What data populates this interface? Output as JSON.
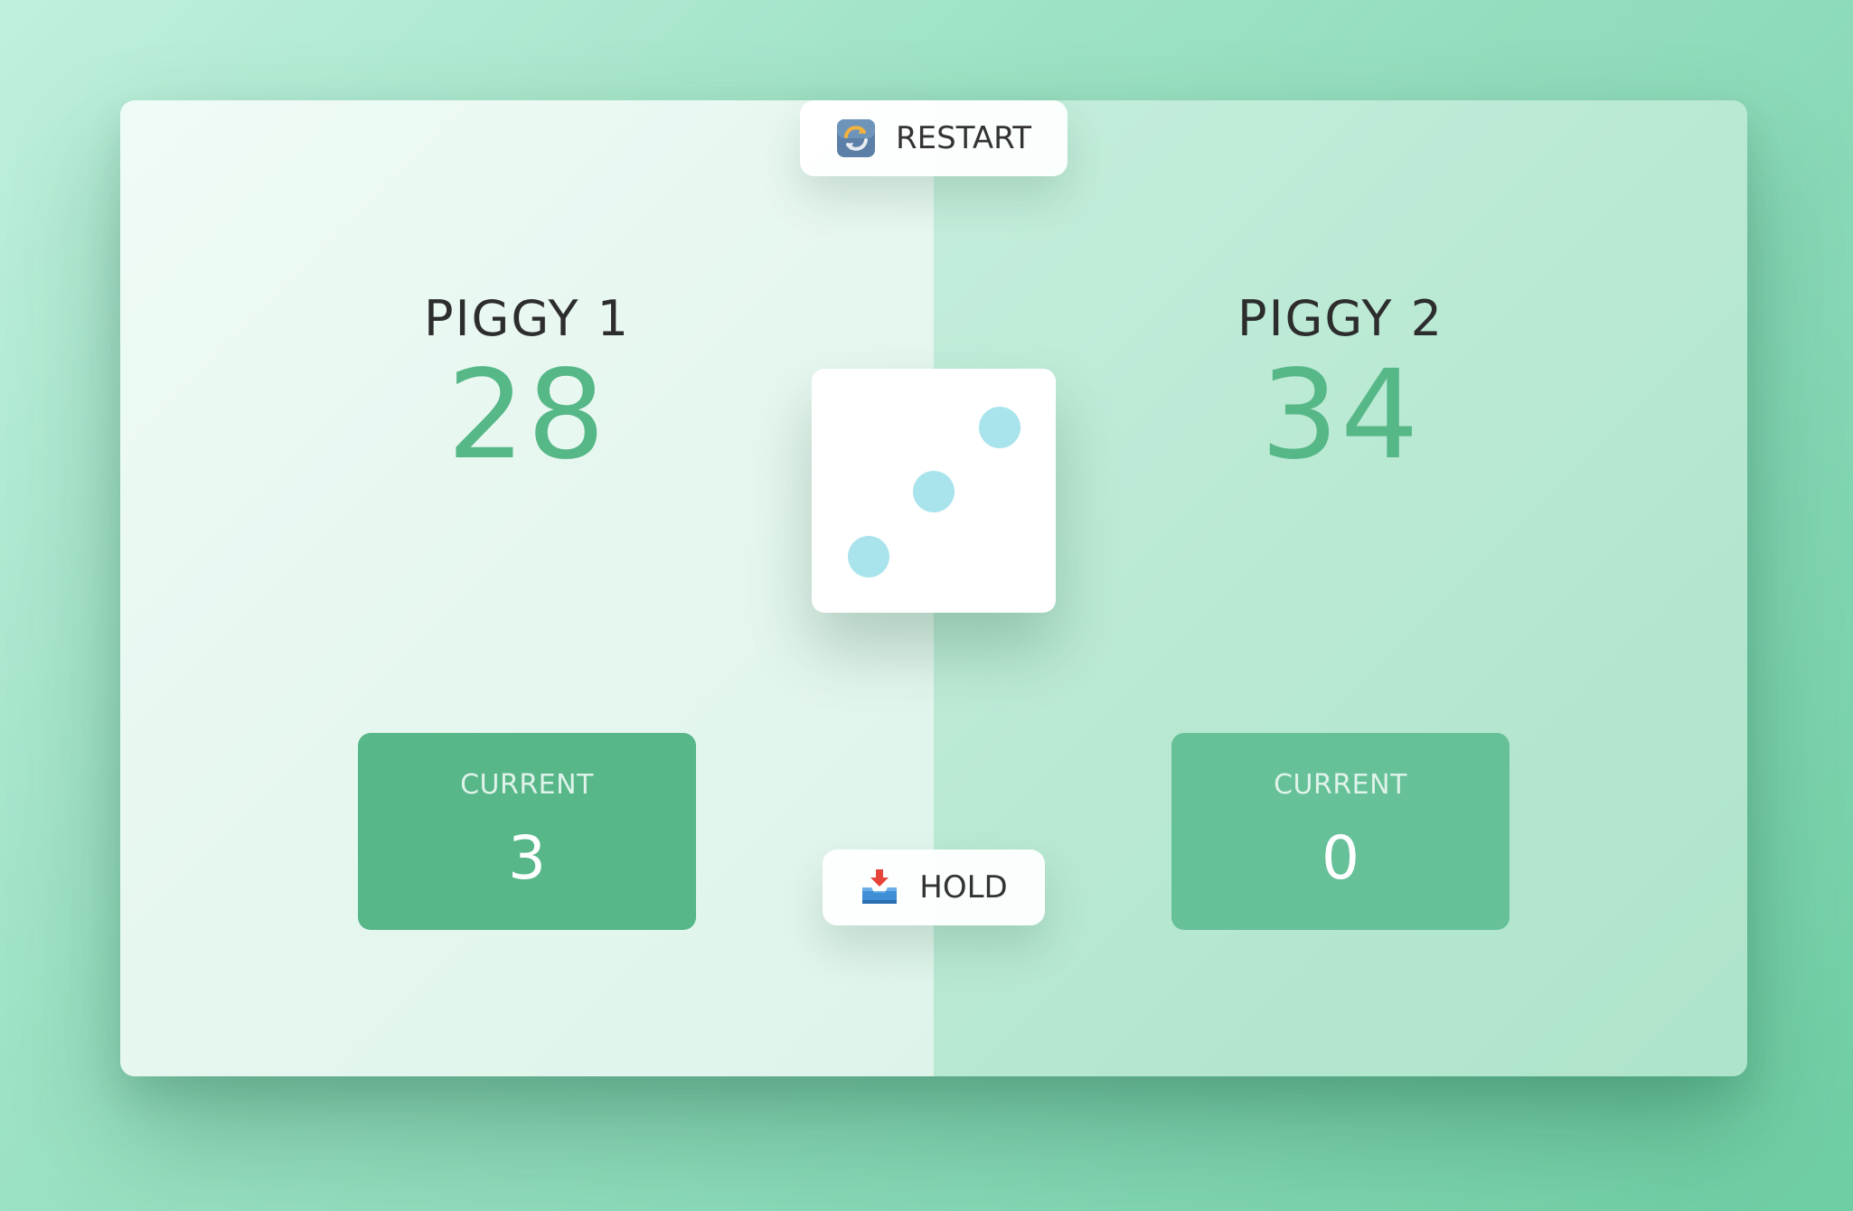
{
  "players": [
    {
      "name": "PIGGY 1",
      "score": "28",
      "current_label": "CURRENT",
      "current_score": "3"
    },
    {
      "name": "PIGGY 2",
      "score": "34",
      "current_label": "CURRENT",
      "current_score": "0"
    }
  ],
  "controls": {
    "restart_label": "RESTART",
    "restart_icon": "restart-arrows-icon",
    "hold_label": "HOLD",
    "hold_icon": "inbox-tray-icon"
  },
  "dice": {
    "value": 3,
    "pip_color": "#a9e3ec"
  },
  "colors": {
    "score": "#56b787",
    "current_box_active": "#57b789",
    "current_box_inactive": "#66c199"
  }
}
